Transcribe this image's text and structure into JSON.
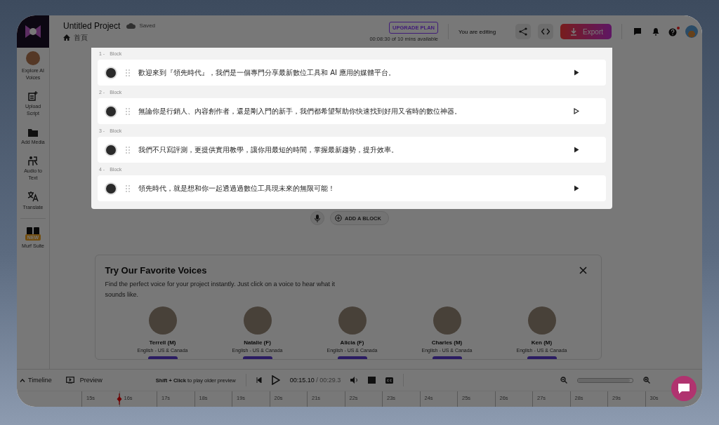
{
  "project": {
    "title": "Untitled Project",
    "save_status": "Saved",
    "breadcrumb": "首頁"
  },
  "header": {
    "upgrade_button": "UPGRADE PLAN",
    "usage": "00:08:30 of 10 mins available",
    "editing_status": "You are editing",
    "export_button": "Export",
    "help_notification": true
  },
  "sidebar": {
    "items": [
      {
        "label": "Explore AI Voices",
        "kind": "avatar"
      },
      {
        "label": "Upload Script",
        "kind": "upload"
      },
      {
        "label": "Add Media",
        "kind": "media"
      },
      {
        "label": "Audio to Text",
        "kind": "transcribe"
      },
      {
        "label": "Translate",
        "kind": "translate"
      },
      {
        "label": "Murf Suite",
        "kind": "suite",
        "badge": "NEW"
      }
    ]
  },
  "blocks": [
    {
      "number": "1 -",
      "label": "Block",
      "text": "歡迎來到『領先時代』，我們是一個專門分享最新數位工具和 AI 應用的媒體平台。",
      "play_outlined": false
    },
    {
      "number": "2 -",
      "label": "Block",
      "text": "無論你是行銷人、內容創作者，還是剛入門的新手，我們都希望幫助你快速找到好用又省時的數位神器。",
      "play_outlined": true
    },
    {
      "number": "3 -",
      "label": "Block",
      "text": "我們不只寫評測，更提供實用教學，讓你用最短的時間，掌握最新趨勢，提升效率。",
      "play_outlined": false
    },
    {
      "number": "4 -",
      "label": "Block",
      "text": "領先時代，就是想和你一起透過過數位工具現未來的無限可能！",
      "play_outlined": false
    }
  ],
  "add_block_button": "ADD A BLOCK",
  "voices_card": {
    "title": "Try Our Favorite Voices",
    "description": "Find the perfect voice for your project instantly. Just click on a voice to hear what it sounds like.",
    "voices": [
      {
        "name": "Terrell (M)",
        "accent": "English - US & Canada"
      },
      {
        "name": "Natalie (F)",
        "accent": "English - US & Canada"
      },
      {
        "name": "Alicia (F)",
        "accent": "English - US & Canada"
      },
      {
        "name": "Charles (M)",
        "accent": "English - US & Canada"
      },
      {
        "name": "Ken (M)",
        "accent": "English - US & Canada"
      }
    ]
  },
  "player": {
    "timeline_toggle": "Timeline",
    "preview_button": "Preview",
    "hint": "**Shift + Click** to play older preview",
    "current_time": "00:15.10",
    "total_time": "/ 00:29.3",
    "zoom": {
      "level": 0.95
    }
  },
  "ruler": {
    "ticks": [
      "15s",
      "16s",
      "17s",
      "18s",
      "19s",
      "20s",
      "21s",
      "22s",
      "23s",
      "24s",
      "25s",
      "26s",
      "27s",
      "28s",
      "29s",
      "30s"
    ]
  }
}
